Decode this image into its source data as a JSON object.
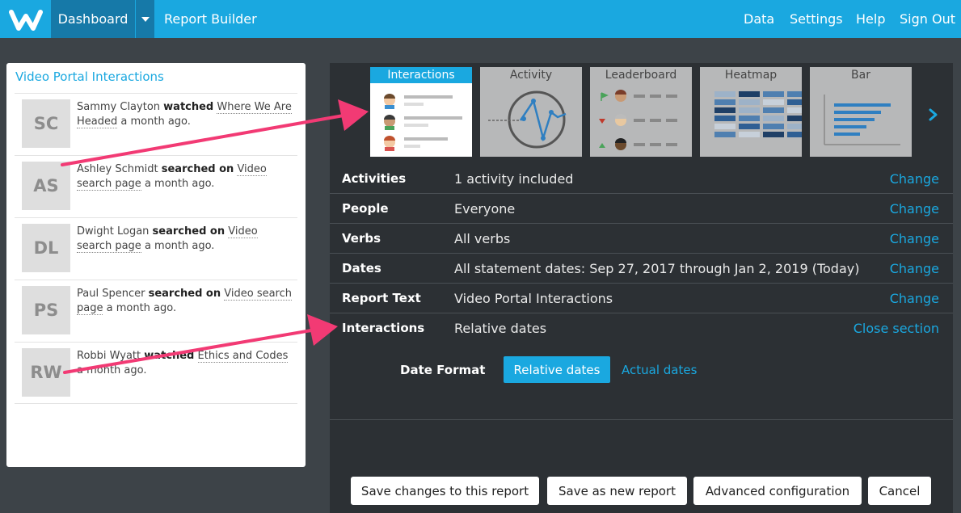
{
  "nav": {
    "dashboard": "Dashboard",
    "report_builder": "Report Builder",
    "data": "Data",
    "settings": "Settings",
    "help": "Help",
    "sign_out": "Sign Out"
  },
  "colors": {
    "brand": "#1aa8e0",
    "nav_active": "#1679a8",
    "panel_dark": "#2c3034",
    "arrow": "#f23a74"
  },
  "left": {
    "title": "Video Portal Interactions",
    "items": [
      {
        "initials": "SC",
        "name": "Sammy Clayton",
        "verb": "watched",
        "pre": "",
        "object": "Where We Are Headed",
        "time": "a month ago."
      },
      {
        "initials": "AS",
        "name": "Ashley Schmidt",
        "verb": "searched on",
        "pre": "",
        "object": "Video search page",
        "time": "a month ago."
      },
      {
        "initials": "DL",
        "name": "Dwight Logan",
        "verb": "searched on",
        "pre": "",
        "object": "Video search page",
        "time": "a month ago."
      },
      {
        "initials": "PS",
        "name": "Paul Spencer",
        "verb": "searched on",
        "pre": "",
        "object": "Video search page",
        "time": "a month ago."
      },
      {
        "initials": "RW",
        "name": "Robbi Wyatt",
        "verb": "watched",
        "pre": "",
        "object": "Ethics and Codes",
        "time": "a month ago."
      }
    ]
  },
  "thumbs": [
    "Interactions",
    "Activity",
    "Leaderboard",
    "Heatmap",
    "Bar"
  ],
  "settings_rows": [
    {
      "key": "Activities",
      "value": "1 activity included",
      "action": "Change"
    },
    {
      "key": "People",
      "value": "Everyone",
      "action": "Change"
    },
    {
      "key": "Verbs",
      "value": "All verbs",
      "action": "Change"
    },
    {
      "key": "Dates",
      "value": "All statement dates: Sep 27, 2017 through Jan 2, 2019 (Today)",
      "action": "Change"
    },
    {
      "key": "Report Text",
      "value": "Video Portal Interactions",
      "action": "Change"
    },
    {
      "key": "Interactions",
      "value": "Relative dates",
      "action": "Close section"
    }
  ],
  "date_format": {
    "label": "Date Format",
    "selected": "Relative dates",
    "alternative": "Actual dates"
  },
  "buttons": {
    "save_changes": "Save changes to this report",
    "save_new": "Save as new report",
    "advanced": "Advanced configuration",
    "cancel": "Cancel"
  }
}
